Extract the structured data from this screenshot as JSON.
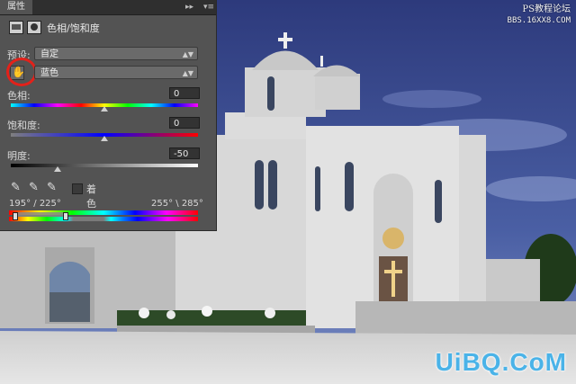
{
  "watermark_top": {
    "line1": "PS教程论坛",
    "line2": "BBS.16XX8.COM"
  },
  "watermark_bottom": "UiBQ.CoM",
  "panel": {
    "tab": "属性",
    "header_label": "色相/饱和度",
    "preset_label": "预设:",
    "preset_value": "自定",
    "channel_value": "蓝色",
    "hue": {
      "label": "色相:",
      "value": "0",
      "fraction": 0.5
    },
    "saturation": {
      "label": "饱和度:",
      "value": "0",
      "fraction": 0.5
    },
    "lightness": {
      "label": "明度:",
      "value": "-50",
      "fraction": 0.25
    },
    "colorize_label": "着色",
    "range_left": "195° / 225°",
    "range_right": "255° \\ 285°"
  },
  "colors": {
    "panel_bg": "#535353",
    "highlight_ring": "#e3211a",
    "sky": "#3c4f92",
    "watermark": "#4ab3e8"
  },
  "icons": [
    "hue-saturation-icon",
    "mask-icon",
    "hand-targeted-adjust-icon",
    "eyedropper-icon",
    "eyedropper-plus-icon",
    "eyedropper-minus-icon"
  ]
}
